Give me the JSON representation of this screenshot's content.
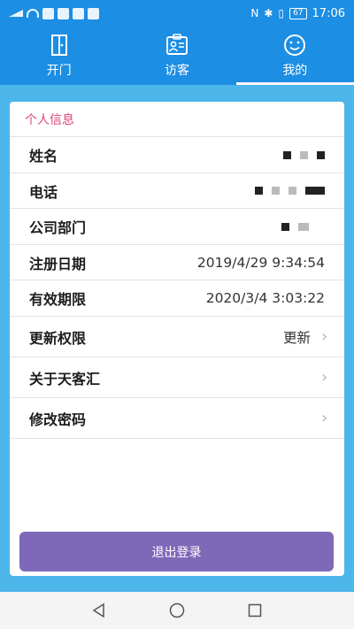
{
  "statusbar": {
    "battery": "67",
    "time": "17:06"
  },
  "tabs": [
    {
      "label": "开门",
      "icon": "door-icon"
    },
    {
      "label": "访客",
      "icon": "visitor-badge-icon"
    },
    {
      "label": "我的",
      "icon": "smiley-icon"
    }
  ],
  "profile": {
    "section_title": "个人信息",
    "name_label": "姓名",
    "phone_label": "电话",
    "department_label": "公司部门",
    "register_date_label": "注册日期",
    "register_date_value": "2019/4/29 9:34:54",
    "expiry_label": "有效期限",
    "expiry_value": "2020/3/4 3:03:22",
    "update_perm_label": "更新权限",
    "update_perm_value": "更新",
    "about_label": "关于天客汇",
    "change_pwd_label": "修改密码",
    "logout_label": "退出登录"
  },
  "colors": {
    "header_blue": "#1c8ee3",
    "background_blue": "#4cb6ea",
    "section_title_pink": "#e0457b",
    "logout_purple": "#7e69b8"
  }
}
